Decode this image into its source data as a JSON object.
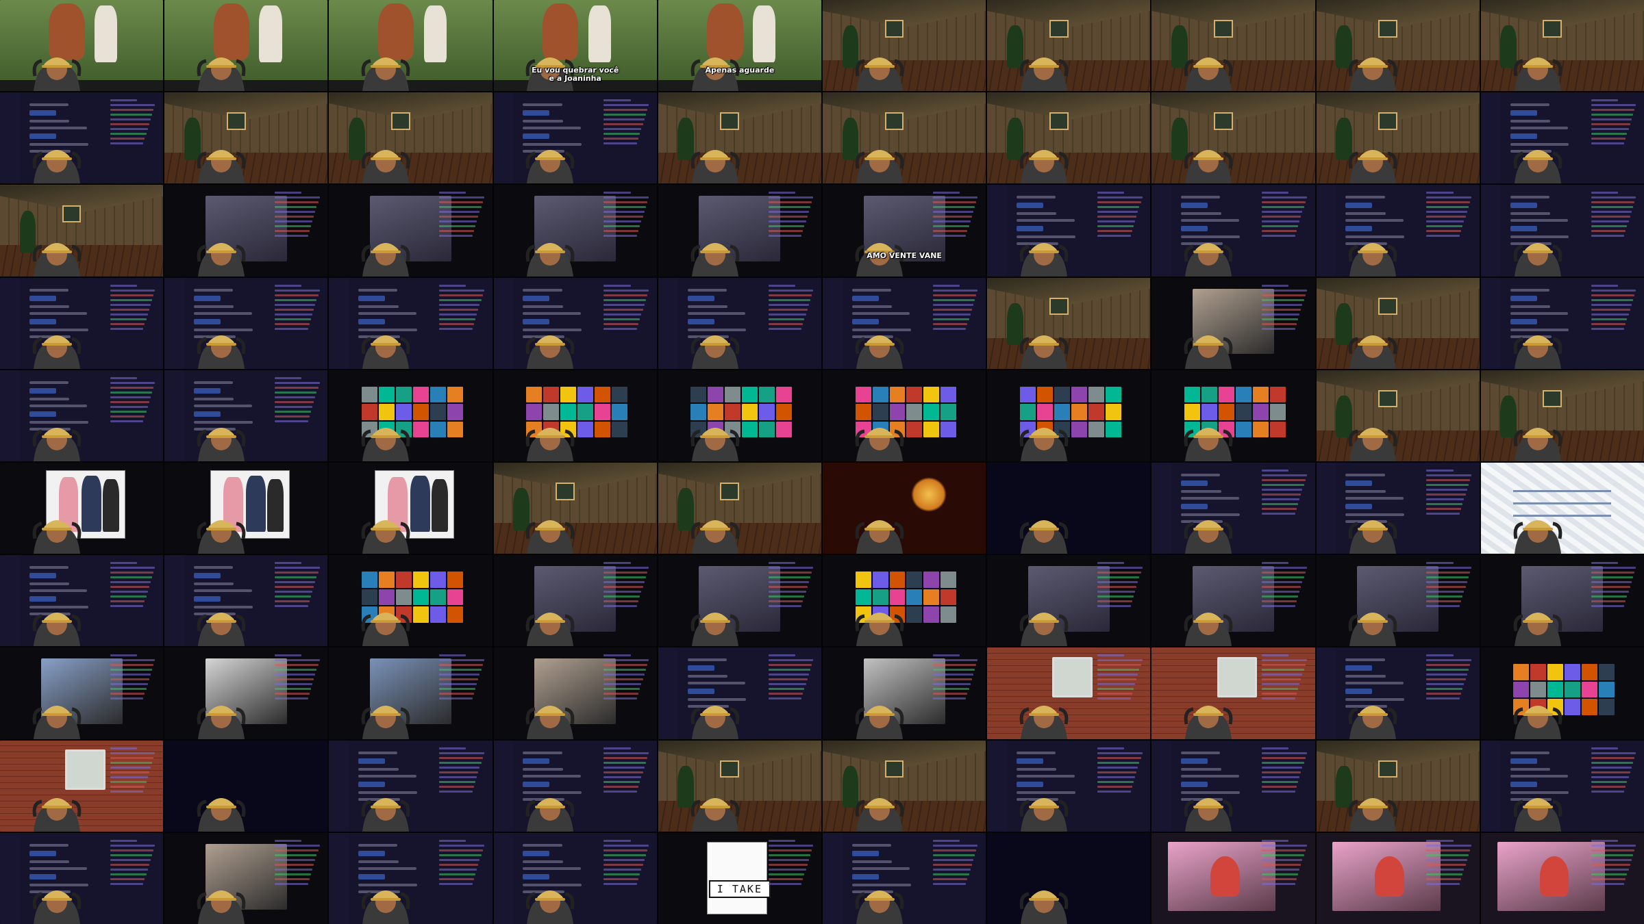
{
  "mosaic": {
    "columns": 10,
    "rows": 10
  },
  "captions": {
    "tile_3_0": "Eu vou quebrar você",
    "tile_4_0": "Apenas aguarde",
    "tile_3_0_line2": "e a Joaninha",
    "tile_2_5": "AMO VENTE VANE",
    "tile_3_9": "I TAKE"
  },
  "tile_kinds": [
    "orangutan",
    "orangutan",
    "orangutan",
    "orangutan",
    "orangutan",
    "room",
    "room",
    "room",
    "room",
    "room",
    "dash",
    "room",
    "room",
    "dash",
    "room",
    "room",
    "room",
    "room",
    "room",
    "dash",
    "room",
    "video",
    "video",
    "video",
    "video",
    "video",
    "dash",
    "dash",
    "dash",
    "dash",
    "dash",
    "dash",
    "dash",
    "dash",
    "dash",
    "dash",
    "room",
    "photo",
    "room",
    "dash",
    "dash",
    "dash",
    "thumbs",
    "thumbs",
    "thumbs",
    "thumbs",
    "thumbs",
    "thumbs",
    "room",
    "room",
    "whiteboard",
    "whiteboard",
    "whiteboard",
    "room",
    "room",
    "fire",
    "dark",
    "dash",
    "dash",
    "map",
    "dash",
    "dash",
    "thumbs",
    "video",
    "video",
    "thumbs",
    "video",
    "video",
    "video",
    "video",
    "photo",
    "photo",
    "photo",
    "photo",
    "dash",
    "photo",
    "brick",
    "brick",
    "dash",
    "thumbs",
    "brick",
    "dark",
    "dash",
    "dash",
    "room",
    "room",
    "dash",
    "dash",
    "room",
    "dash",
    "dash",
    "photo",
    "dash",
    "dash",
    "itake",
    "dash",
    "dark",
    "pink",
    "pink",
    "pink"
  ],
  "palette": {
    "dash_bg": "#16142c",
    "dark_bg": "#0b0b0f",
    "accent_purple": "#9147ff",
    "accent_green": "#3ec46d",
    "accent_red": "#d85a5a",
    "forest_green": "#3d5a2a",
    "pink_room": "#e9a3c9"
  }
}
